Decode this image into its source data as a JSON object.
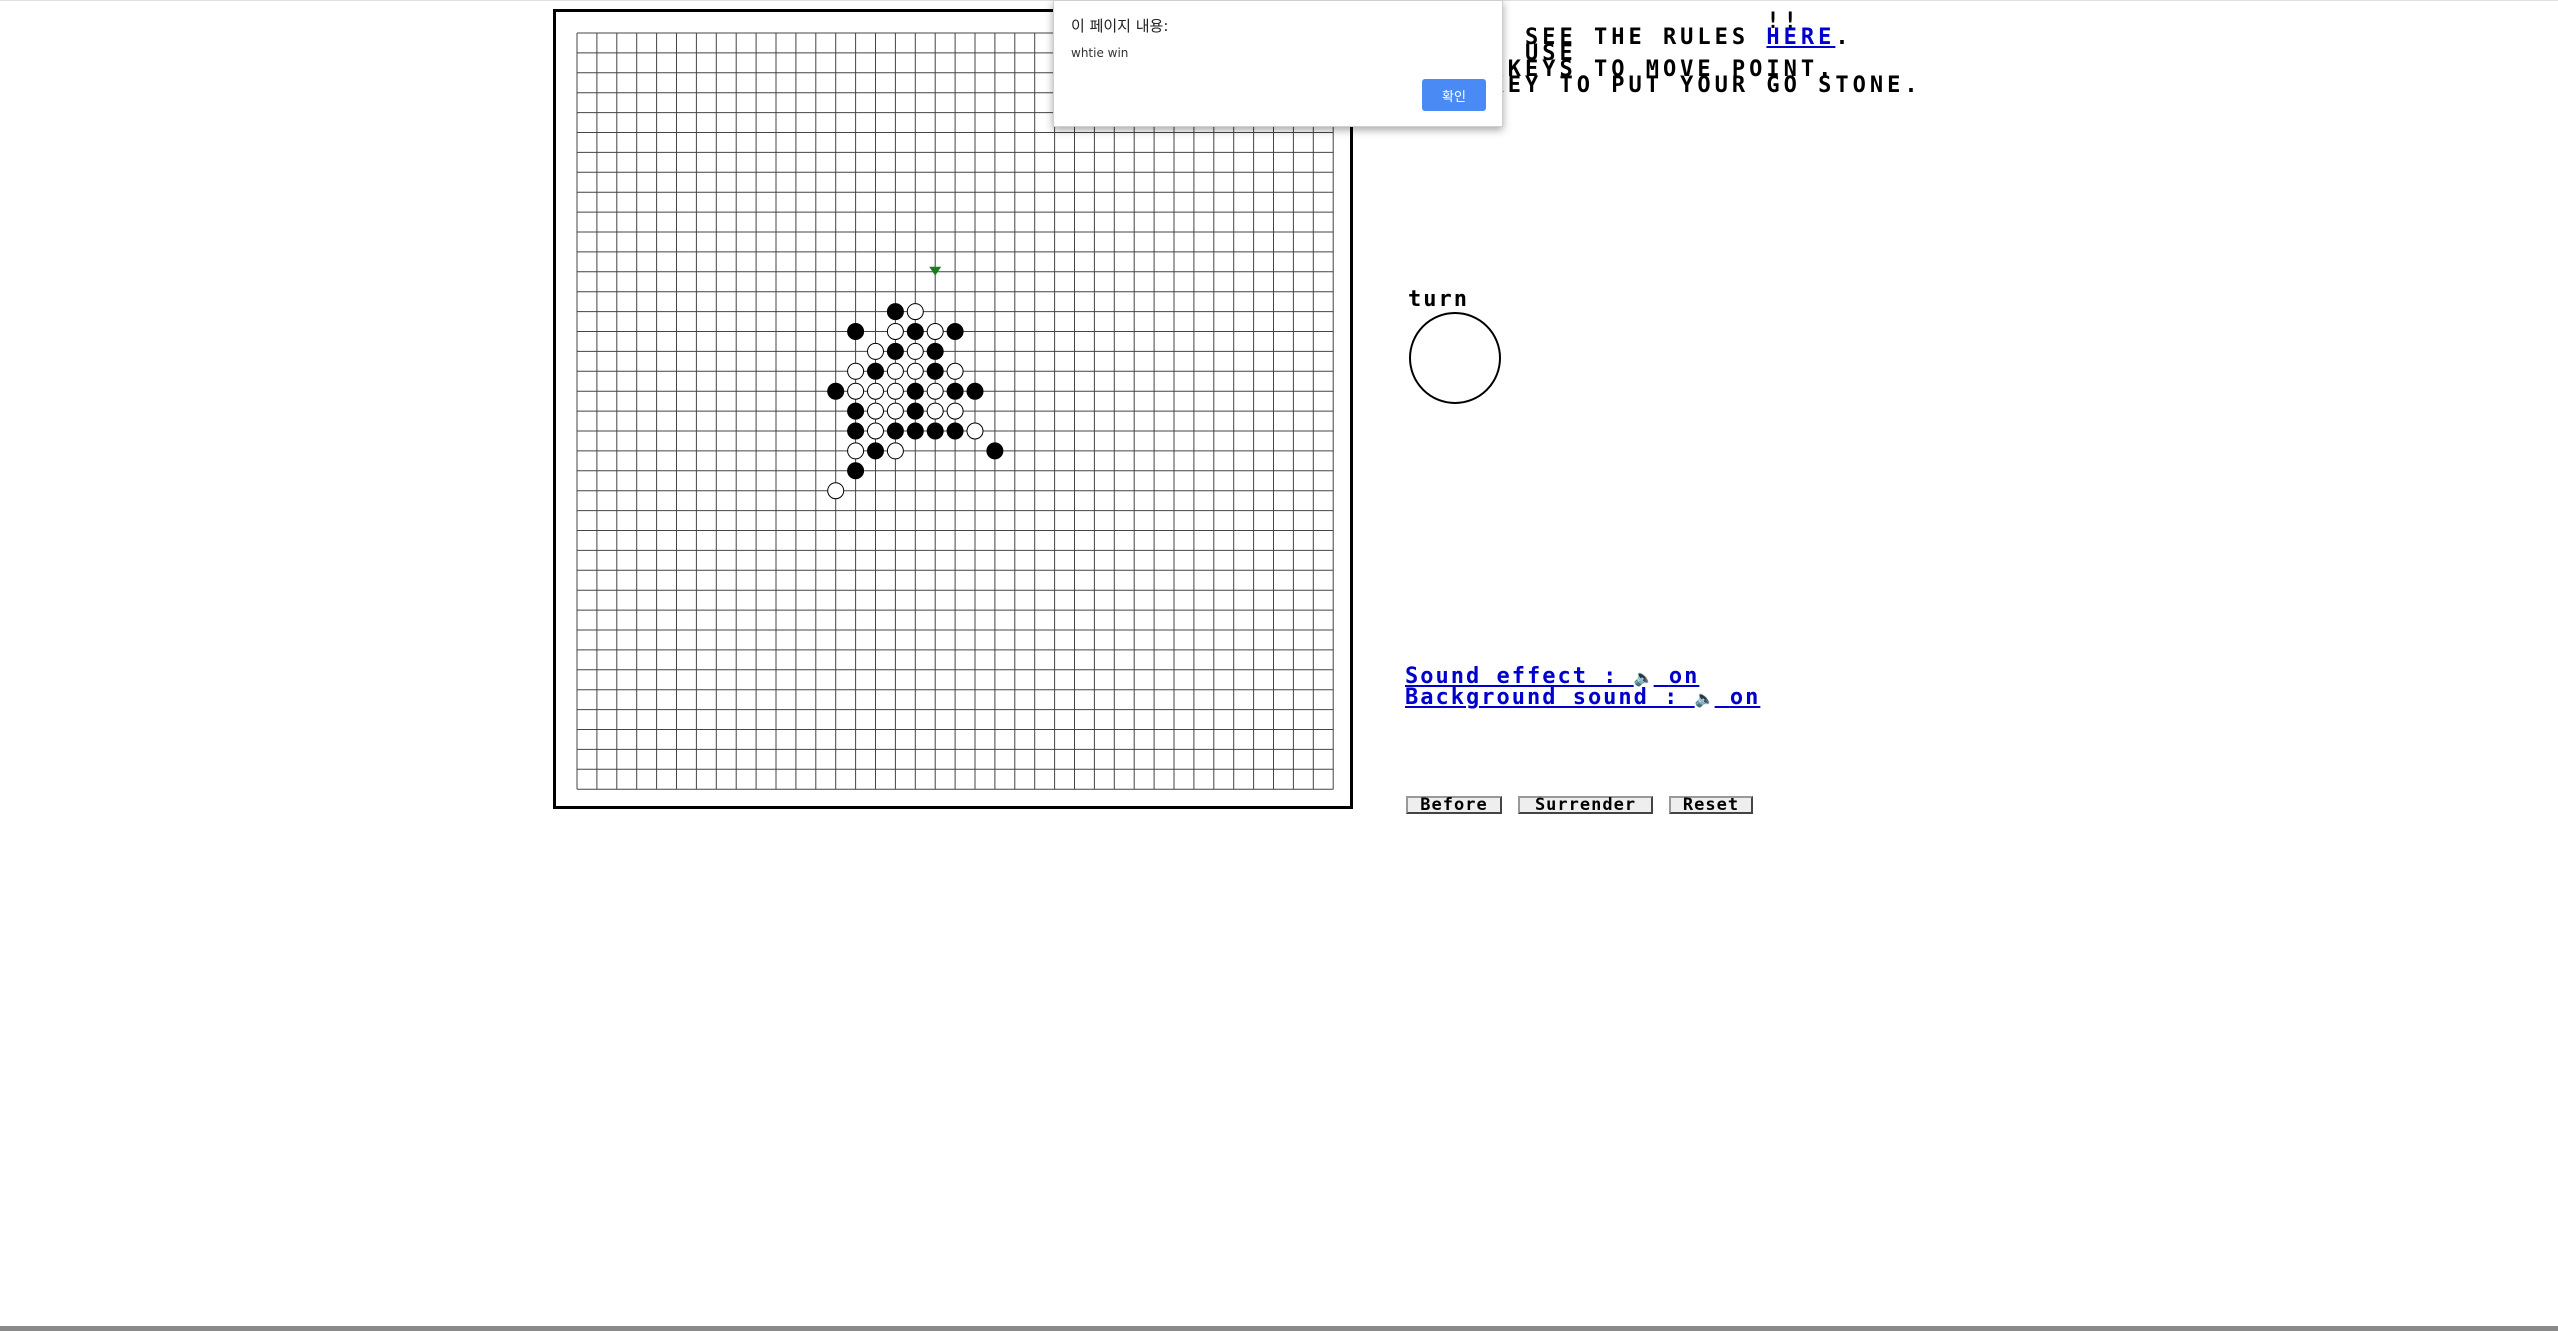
{
  "info": {
    "line1": "                  !!",
    "line2_pre": "  N SEE THE RULES ",
    "line2_link": "HERE",
    "line2_post": ".",
    "line3": "  N USE",
    "line4": "   KEYS TO MOVE POINT.",
    "line5": "  KEY TO PUT YOUR GO STONE."
  },
  "turn": {
    "label": "turn",
    "stone": "white"
  },
  "sound": {
    "effect_label": "Sound effect : ",
    "effect_state": "on",
    "background_label": "Background sound : ",
    "background_state": "on",
    "icon": "speaker-icon"
  },
  "buttons": {
    "before": "Before",
    "surrender": "Surrender",
    "reset": "Reset"
  },
  "dialog": {
    "title": "이 페이지 내용:",
    "message": "whtie win",
    "ok": "확인",
    "ok_color": "#4a8af4"
  },
  "board": {
    "size": 39,
    "marker": {
      "col": 18,
      "row": 12,
      "color": "#1a7f1a"
    },
    "stones": [
      {
        "c": 16,
        "r": 14,
        "color": "black"
      },
      {
        "c": 17,
        "r": 14,
        "color": "white"
      },
      {
        "c": 14,
        "r": 15,
        "color": "black"
      },
      {
        "c": 16,
        "r": 15,
        "color": "white"
      },
      {
        "c": 17,
        "r": 15,
        "color": "black"
      },
      {
        "c": 18,
        "r": 15,
        "color": "white"
      },
      {
        "c": 19,
        "r": 15,
        "color": "black"
      },
      {
        "c": 15,
        "r": 16,
        "color": "white"
      },
      {
        "c": 16,
        "r": 16,
        "color": "black"
      },
      {
        "c": 17,
        "r": 16,
        "color": "white"
      },
      {
        "c": 18,
        "r": 16,
        "color": "black"
      },
      {
        "c": 14,
        "r": 17,
        "color": "white"
      },
      {
        "c": 15,
        "r": 17,
        "color": "black"
      },
      {
        "c": 16,
        "r": 17,
        "color": "white"
      },
      {
        "c": 17,
        "r": 17,
        "color": "white"
      },
      {
        "c": 18,
        "r": 17,
        "color": "black"
      },
      {
        "c": 19,
        "r": 17,
        "color": "white"
      },
      {
        "c": 13,
        "r": 18,
        "color": "black"
      },
      {
        "c": 14,
        "r": 18,
        "color": "white"
      },
      {
        "c": 15,
        "r": 18,
        "color": "white"
      },
      {
        "c": 16,
        "r": 18,
        "color": "white"
      },
      {
        "c": 17,
        "r": 18,
        "color": "black"
      },
      {
        "c": 18,
        "r": 18,
        "color": "white"
      },
      {
        "c": 19,
        "r": 18,
        "color": "black"
      },
      {
        "c": 20,
        "r": 18,
        "color": "black"
      },
      {
        "c": 14,
        "r": 19,
        "color": "black"
      },
      {
        "c": 15,
        "r": 19,
        "color": "white"
      },
      {
        "c": 16,
        "r": 19,
        "color": "white"
      },
      {
        "c": 17,
        "r": 19,
        "color": "black"
      },
      {
        "c": 18,
        "r": 19,
        "color": "white"
      },
      {
        "c": 19,
        "r": 19,
        "color": "white"
      },
      {
        "c": 14,
        "r": 20,
        "color": "black"
      },
      {
        "c": 15,
        "r": 20,
        "color": "white"
      },
      {
        "c": 16,
        "r": 20,
        "color": "black"
      },
      {
        "c": 17,
        "r": 20,
        "color": "black"
      },
      {
        "c": 18,
        "r": 20,
        "color": "black"
      },
      {
        "c": 19,
        "r": 20,
        "color": "black"
      },
      {
        "c": 20,
        "r": 20,
        "color": "white"
      },
      {
        "c": 14,
        "r": 21,
        "color": "white"
      },
      {
        "c": 15,
        "r": 21,
        "color": "black"
      },
      {
        "c": 16,
        "r": 21,
        "color": "white"
      },
      {
        "c": 21,
        "r": 21,
        "color": "black"
      },
      {
        "c": 14,
        "r": 22,
        "color": "black"
      },
      {
        "c": 13,
        "r": 23,
        "color": "white"
      }
    ]
  }
}
